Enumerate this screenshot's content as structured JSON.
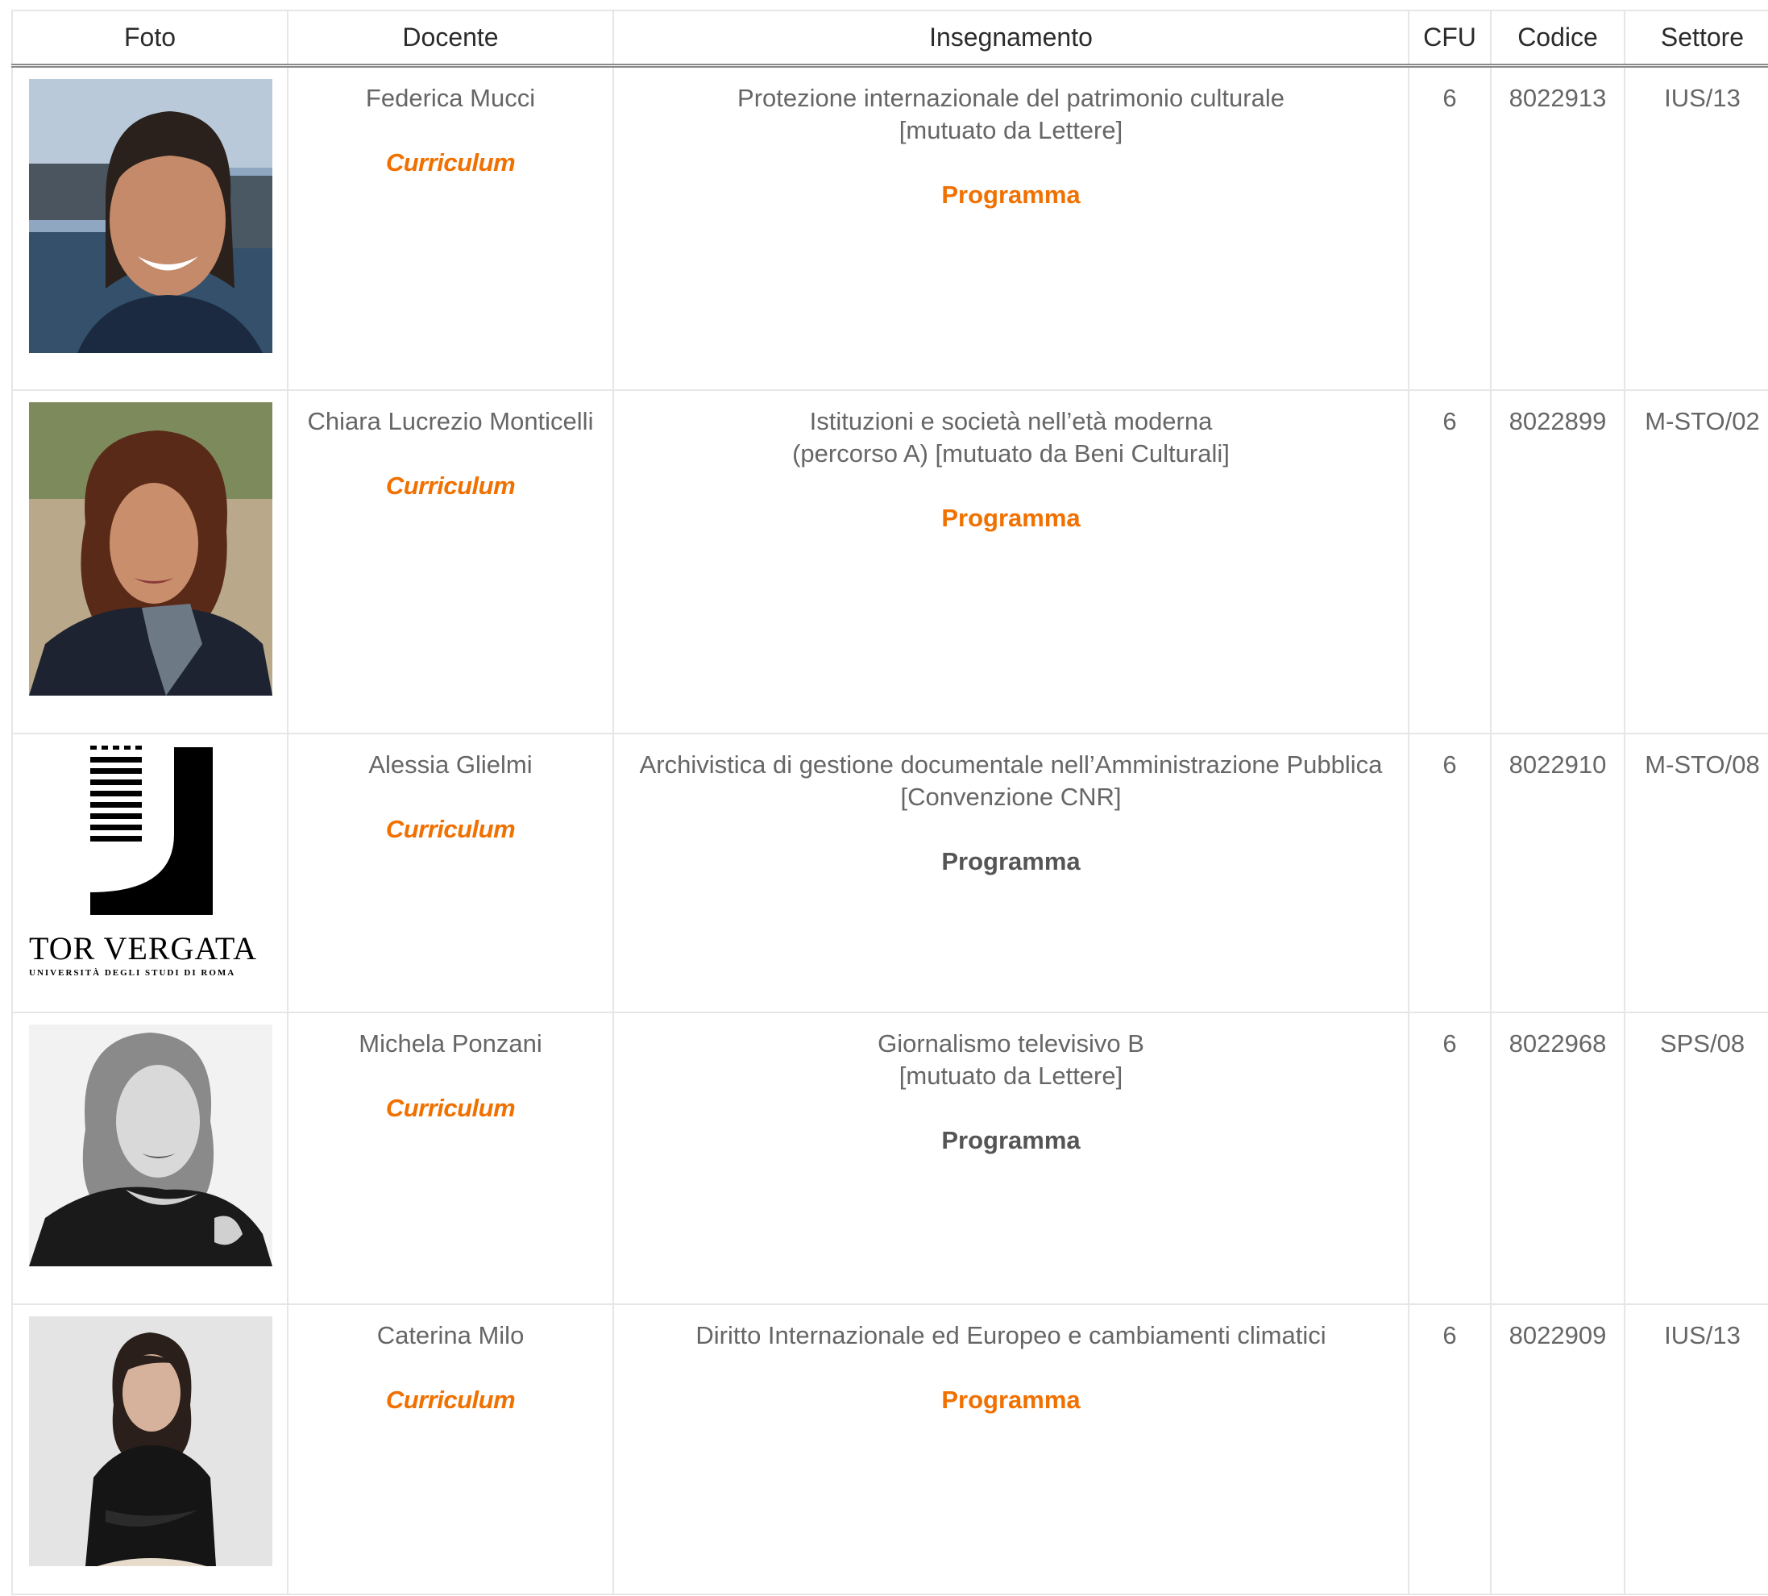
{
  "headers": {
    "foto": "Foto",
    "docente": "Docente",
    "insegnamento": "Insegnamento",
    "cfu": "CFU",
    "codice": "Codice",
    "settore": "Settore"
  },
  "rows": [
    {
      "docente": "Federica Mucci",
      "curriculum": "Curriculum",
      "course_line1": "Protezione internazionale del patrimonio culturale",
      "course_line2": "[mutuato da Lettere]",
      "programma": "Programma",
      "cfu": "6",
      "codice": "8022913",
      "settore": "IUS/13"
    },
    {
      "docente": "Chiara Lucrezio Monticelli",
      "curriculum": "Curriculum",
      "course_line1": "Istituzioni e società nell’età moderna",
      "course_line2": "(percorso A) [mutuato da Beni Culturali]",
      "programma": "Programma",
      "cfu": "6",
      "codice": "8022899",
      "settore": "M-STO/02"
    },
    {
      "docente": "Alessia Glielmi",
      "curriculum": "Curriculum",
      "course_line1": "Archivistica di gestione documentale nell’Amministrazione Pubblica",
      "course_line2": "[Convenzione CNR]",
      "programma": "Programma",
      "cfu": "6",
      "codice": "8022910",
      "settore": "M-STO/08"
    },
    {
      "docente": "Michela Ponzani",
      "curriculum": "Curriculum",
      "course_line1": "Giornalismo televisivo B",
      "course_line2": "[mutuato da Lettere]",
      "programma": "Programma",
      "cfu": "6",
      "codice": "8022968",
      "settore": "SPS/08"
    },
    {
      "docente": "Caterina Milo",
      "curriculum": "Curriculum",
      "course_line1": "Diritto Internazionale ed Europeo e cambiamenti climatici",
      "programma": "Programma",
      "cfu": "6",
      "codice": "8022909",
      "settore": "IUS/13"
    }
  ],
  "logo": {
    "name": "TOR VERGATA",
    "subtitle": "UNIVERSITÀ DEGLI STUDI DI ROMA"
  },
  "colors": {
    "accent_orange": "#f07000",
    "text_grey": "#666666",
    "border": "#e6e6e6"
  }
}
